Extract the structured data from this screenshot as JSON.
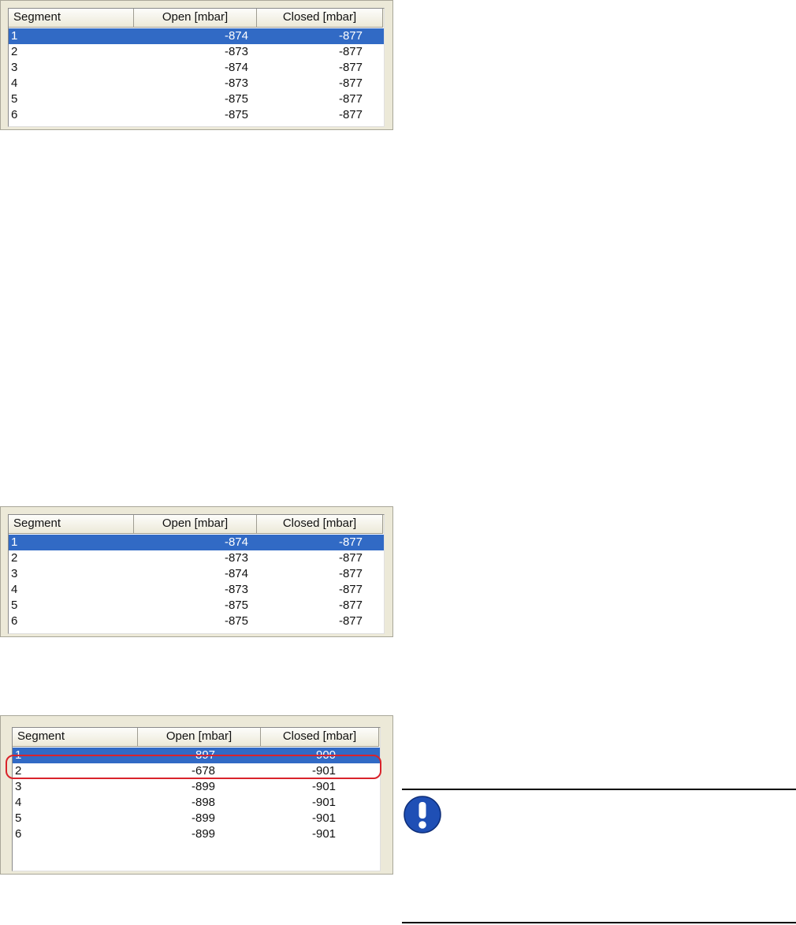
{
  "tables": [
    {
      "columns": [
        "Segment",
        "Open [mbar]",
        "Closed [mbar]"
      ],
      "selected_row": 0,
      "rows": [
        {
          "segment": "1",
          "open": "-874",
          "closed": "-877"
        },
        {
          "segment": "2",
          "open": "-873",
          "closed": "-877"
        },
        {
          "segment": "3",
          "open": "-874",
          "closed": "-877"
        },
        {
          "segment": "4",
          "open": "-873",
          "closed": "-877"
        },
        {
          "segment": "5",
          "open": "-875",
          "closed": "-877"
        },
        {
          "segment": "6",
          "open": "-875",
          "closed": "-877"
        }
      ]
    },
    {
      "columns": [
        "Segment",
        "Open [mbar]",
        "Closed [mbar]"
      ],
      "selected_row": 0,
      "rows": [
        {
          "segment": "1",
          "open": "-874",
          "closed": "-877"
        },
        {
          "segment": "2",
          "open": "-873",
          "closed": "-877"
        },
        {
          "segment": "3",
          "open": "-874",
          "closed": "-877"
        },
        {
          "segment": "4",
          "open": "-873",
          "closed": "-877"
        },
        {
          "segment": "5",
          "open": "-875",
          "closed": "-877"
        },
        {
          "segment": "6",
          "open": "-875",
          "closed": "-877"
        }
      ]
    },
    {
      "columns": [
        "Segment",
        "Open [mbar]",
        "Closed [mbar]"
      ],
      "selected_row": 0,
      "highlighted_row": 1,
      "rows": [
        {
          "segment": "1",
          "open": "-897",
          "closed": "-900"
        },
        {
          "segment": "2",
          "open": "-678",
          "closed": "-901"
        },
        {
          "segment": "3",
          "open": "-899",
          "closed": "-901"
        },
        {
          "segment": "4",
          "open": "-898",
          "closed": "-901"
        },
        {
          "segment": "5",
          "open": "-899",
          "closed": "-901"
        },
        {
          "segment": "6",
          "open": "-899",
          "closed": "-901"
        }
      ]
    }
  ],
  "colors": {
    "selection": "#316ac5",
    "highlight_ring": "#d9232b",
    "note_icon": "#1f4fb5"
  },
  "note": {
    "icon": "exclamation-icon"
  }
}
